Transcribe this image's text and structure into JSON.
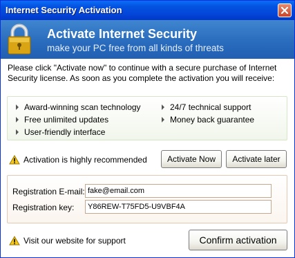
{
  "window": {
    "title": "Internet Security Activation",
    "close_icon": "close-icon"
  },
  "banner": {
    "title": "Activate Internet Security",
    "subtitle": "make your PC free from all kinds of threats",
    "icon": "padlock-icon"
  },
  "intro_text": "Please click \"Activate now\" to continue with a secure purchase of Internet Security license. As soon as you complete the activation you will receive:",
  "features": {
    "left": [
      "Award-winning scan technology",
      "Free unlimited updates",
      "User-friendly interface"
    ],
    "right": [
      "24/7 technical support",
      "Money back guarantee"
    ]
  },
  "recommendation": {
    "text": "Activation is highly recommended",
    "icon": "warning-icon"
  },
  "buttons": {
    "activate_now": "Activate Now",
    "activate_later": "Activate later",
    "confirm": "Confirm activation"
  },
  "registration": {
    "email_label": "Registration E-mail:",
    "email_value": "fake@email.com",
    "key_label": "Registration key:",
    "key_value": "Y86REW-T75FD5-U9VBF4A"
  },
  "support": {
    "text": "Visit our website for support",
    "icon": "warning-icon"
  }
}
